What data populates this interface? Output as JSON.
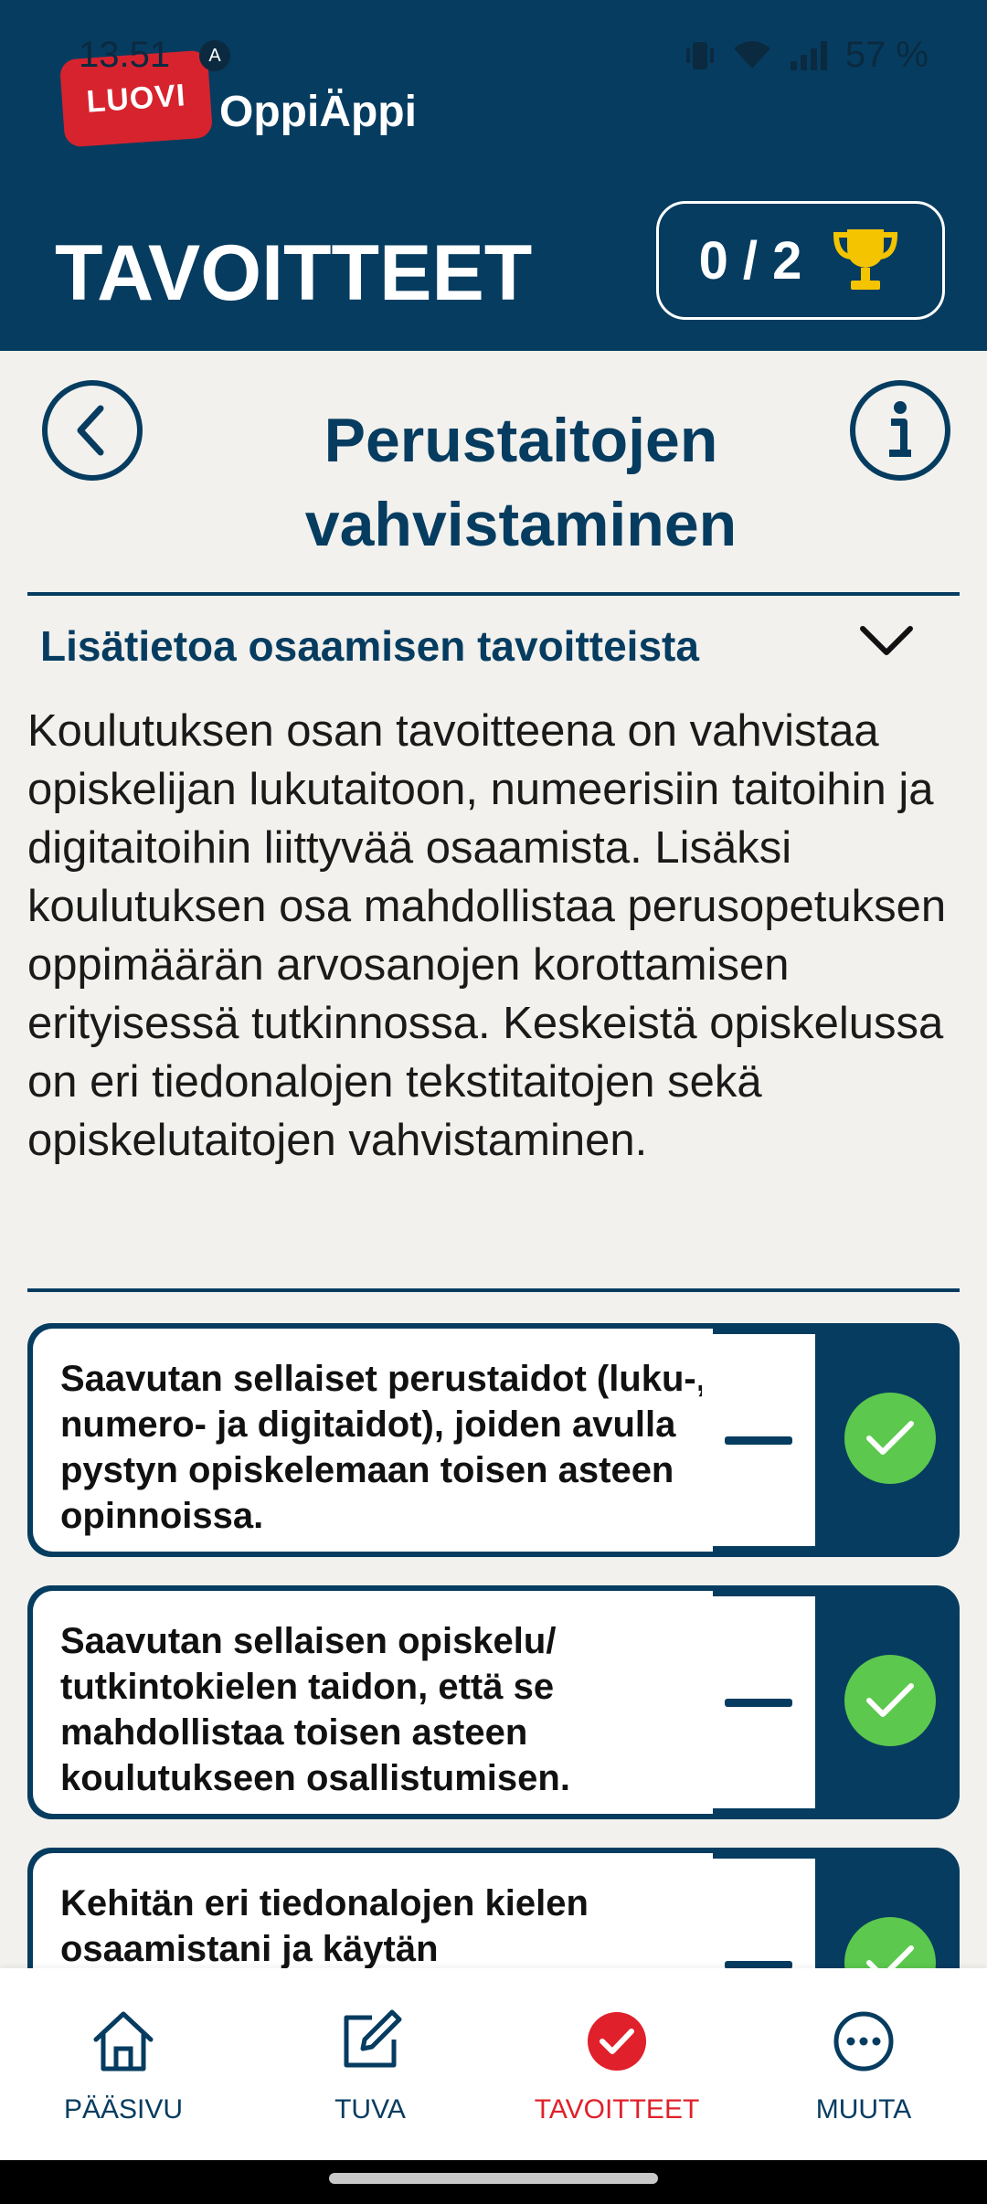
{
  "status_bar": {
    "time": "13.51",
    "notification_icon": "a-icon",
    "battery": "57 %"
  },
  "app": {
    "logo_text": "LUOVI",
    "name": "OppiÄppi"
  },
  "header": {
    "title": "TAVOITTEET",
    "score": "0 / 2",
    "score_icon": "trophy-icon"
  },
  "subheader": {
    "title_line1": "Perustaitojen",
    "title_line2": "vahvistaminen"
  },
  "accordion": {
    "title": "Lisätietoa osaamisen tavoitteista",
    "description": "Koulutuksen osan tavoitteena on vahvistaa opiskelijan lukutaitoon, numeerisiin taitoihin ja digitaitoihin liittyvää osaamista. Lisäksi koulutuksen osa mahdollistaa perusopetuksen oppimäärän arvosanojen korottamisen erityisessä tutkinnossa. Keskeistä opiskelussa on eri tiedonalojen tekstitaitojen sekä opiskelutaitojen vahvistaminen."
  },
  "goals": [
    {
      "text": "Saavutan sellaiset perustaidot (luku-, numero- ja digitaidot), joiden avulla pystyn opiskelemaan toisen asteen opinnoissa."
    },
    {
      "text": "Saavutan sellaisen opiskelu/ tutkintokielen taidon, että se mahdollistaa toisen asteen koulutukseen osallistumisen."
    },
    {
      "text": "Kehitän eri tiedonalojen kielen osaamistani ja käytän"
    }
  ],
  "nav": {
    "items": [
      {
        "label": "PÄÄSIVU",
        "icon": "home-icon"
      },
      {
        "label": "TUVA",
        "icon": "edit-icon"
      },
      {
        "label": "TAVOITTEET",
        "icon": "check-circle-icon",
        "active": true
      },
      {
        "label": "MUUTA",
        "icon": "more-icon"
      }
    ]
  },
  "colors": {
    "primary": "#063c60",
    "accent_red": "#e0202a",
    "check_green": "#5cc84e",
    "background": "#f2f1ed"
  }
}
